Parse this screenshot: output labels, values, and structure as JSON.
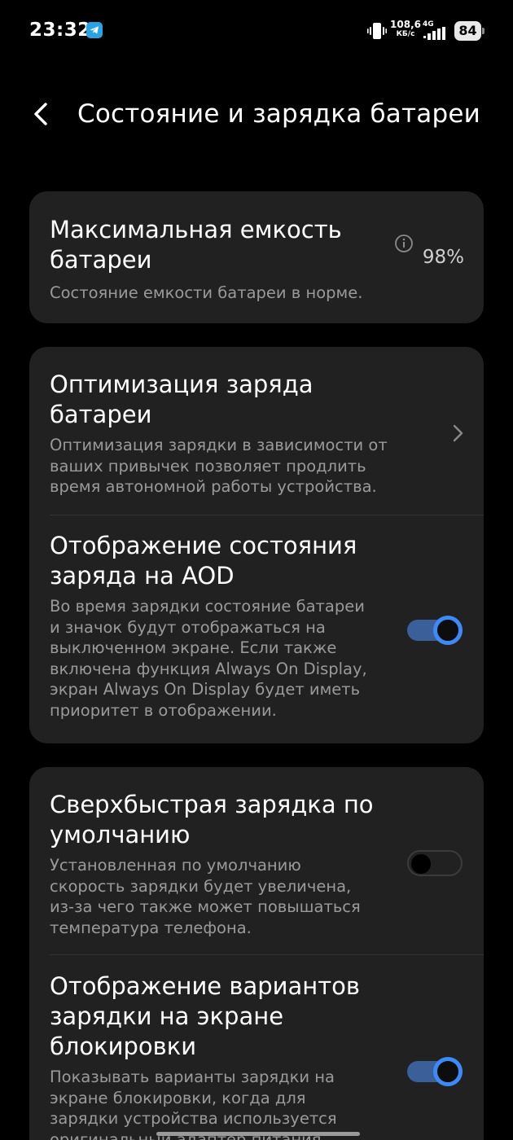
{
  "status_bar": {
    "time": "23:32",
    "speed_value": "108,6",
    "speed_unit": "КБ/с",
    "network": "4G",
    "battery_level": "84",
    "icons": [
      "telegram-icon",
      "vibrate-icon",
      "signal-icon",
      "battery-icon"
    ]
  },
  "header": {
    "title": "Состояние и зарядка батареи",
    "back_icon": "chevron-left-icon"
  },
  "max_capacity": {
    "title_line1": "Максимальная емкость",
    "title_line2": "батареи",
    "value": "98%",
    "description": "Состояние емкости батареи в норме."
  },
  "charge_optimization": {
    "title_line1": "Оптимизация заряда",
    "title_line2": "батареи",
    "desc_line1": "Оптимизация зарядки в зависимости от",
    "desc_line2": "ваших привычек позволяет продлить",
    "desc_line3": "время автономной работы устройства."
  },
  "aod_status": {
    "title_line1": "Отображение состояния",
    "title_line2": "заряда на AOD",
    "desc_line1": "Во время зарядки состояние батареи",
    "desc_line2": "и значок будут отображаться на",
    "desc_line3": "выключенном экране. Если также",
    "desc_line4": "включена функция Always On Display,",
    "desc_line5": "экран Always On Display будет иметь",
    "desc_line6": "приоритет в отображении.",
    "enabled": true
  },
  "superfast_charge": {
    "title_line1": "Сверхбыстрая зарядка по",
    "title_line2": "умолчанию",
    "desc_line1": "Установленная по умолчанию",
    "desc_line2": "скорость зарядки будет увеличена,",
    "desc_line3": "из-за чего также может повышаться",
    "desc_line4": "температура телефона.",
    "enabled": false
  },
  "lockscreen_options": {
    "title_line1": "Отображение вариантов",
    "title_line2": "зарядки на экране",
    "title_line3": "блокировки",
    "desc_line1": "Показывать варианты зарядки на",
    "desc_line2": "экране блокировки, когда для",
    "desc_line3": "зарядки устройства используется",
    "desc_line4": "оригинальный адаптер питания.",
    "enabled": true
  },
  "colors": {
    "background": "#000000",
    "card": "#212121",
    "accent": "#3d8af7",
    "secondary_text": "#9a9a9a"
  }
}
